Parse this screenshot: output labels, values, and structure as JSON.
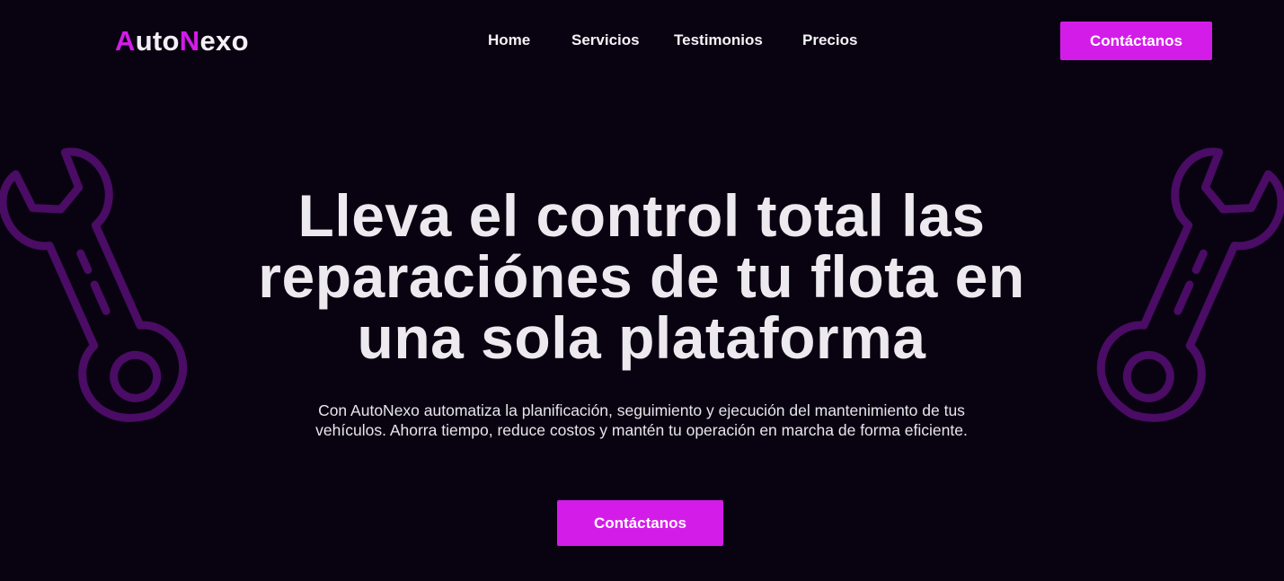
{
  "brand": {
    "logo_a": "A",
    "logo_uto": "uto",
    "logo_n": "N",
    "logo_exo": "exo",
    "accent_color": "#d41ce9",
    "background_color": "#090311"
  },
  "nav": {
    "items": [
      {
        "label": "Home"
      },
      {
        "label": "Servicios"
      },
      {
        "label": "Testimonios"
      },
      {
        "label": "Precios"
      }
    ],
    "cta_label": "Contáctanos"
  },
  "hero": {
    "title_lines": [
      "Lleva el control total las",
      "reparaciónes de tu flota en",
      "una sola plataforma"
    ],
    "subtitle_lines": [
      "Con AutoNexo automatiza la planificación, seguimiento y ejecución del mantenimiento de tus",
      "vehículos. Ahorra tiempo, reduce costos y mantén tu operación en marcha de forma eficiente."
    ],
    "cta_label": "Contáctanos",
    "decor_icons": [
      "wrench-icon",
      "wrench-icon"
    ]
  }
}
